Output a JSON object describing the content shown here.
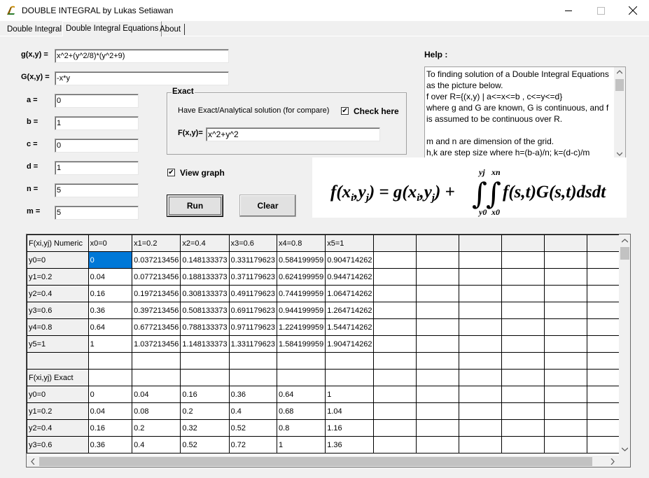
{
  "window": {
    "title": "DOUBLE  INTEGRAL  by Lukas Setiawan"
  },
  "tabs": [
    {
      "label": "Double Integral"
    },
    {
      "label": "Double Integral Equations"
    },
    {
      "label": "About"
    }
  ],
  "form": {
    "g_label": "g(x,y) =",
    "g_value": "x^2+(y^2/8)*(y^2+9)",
    "G_label": "G(x,y) =",
    "G_value": "-x*y",
    "a_label": "a =",
    "a_value": "0",
    "b_label": "b =",
    "b_value": "1",
    "c_label": "c =",
    "c_value": "0",
    "d_label": "d =",
    "d_value": "1",
    "n_label": "n =",
    "n_value": "5",
    "m_label": "m =",
    "m_value": "5"
  },
  "exact": {
    "group_title": "Exact",
    "description": "Have Exact/Analytical solution (for compare)",
    "check_label": "Check here",
    "check_checked": true,
    "F_label": "F(x,y)=",
    "F_value": "x^2+y^2"
  },
  "view_graph": {
    "label": "View graph",
    "checked": true
  },
  "buttons": {
    "run": "Run",
    "clear": "Clear"
  },
  "help": {
    "label": "Help :",
    "text": "To finding solution of a Double Integral Equations as the picture below.\nf over R={(x,y) | a<=x<=b , c<=y<=d}\nwhere g and G are known, G is continuous, and f is assumed to be continuous over R.\n\nm and n are dimension of the grid.\nh,k are step size where h=(b-a)/n; k=(d-c)/m"
  },
  "formula": {
    "text": "f(xi,yj) = g(xi,yj) + ∫∫ f(s,t)G(s,t)dsdt",
    "upper_y": "yj",
    "upper_x": "xn",
    "lower_y": "y0",
    "lower_x": "x0"
  },
  "grid": {
    "header": [
      "F(xi,yj) Numeric",
      "x0=0",
      "x1=0.2",
      "x2=0.4",
      "x3=0.6",
      "x4=0.8",
      "x5=1",
      "",
      "",
      "",
      "",
      "",
      ""
    ],
    "rows": [
      [
        "y0=0",
        "0",
        "0.037213456",
        "0.148133373",
        "0.331179623",
        "0.584199959",
        "0.904714262",
        "",
        "",
        "",
        "",
        "",
        ""
      ],
      [
        "y1=0.2",
        "0.04",
        "0.077213456",
        "0.188133373",
        "0.371179623",
        "0.624199959",
        "0.944714262",
        "",
        "",
        "",
        "",
        "",
        ""
      ],
      [
        "y2=0.4",
        "0.16",
        "0.197213456",
        "0.308133373",
        "0.491179623",
        "0.744199959",
        "1.064714262",
        "",
        "",
        "",
        "",
        "",
        ""
      ],
      [
        "y3=0.6",
        "0.36",
        "0.397213456",
        "0.508133373",
        "0.691179623",
        "0.944199959",
        "1.264714262",
        "",
        "",
        "",
        "",
        "",
        ""
      ],
      [
        "y4=0.8",
        "0.64",
        "0.677213456",
        "0.788133373",
        "0.971179623",
        "1.224199959",
        "1.544714262",
        "",
        "",
        "",
        "",
        "",
        ""
      ],
      [
        "y5=1",
        "1",
        "1.037213456",
        "1.148133373",
        "1.331179623",
        "1.584199959",
        "1.904714262",
        "",
        "",
        "",
        "",
        "",
        ""
      ],
      [
        "",
        "",
        "",
        "",
        "",
        "",
        "",
        "",
        "",
        "",
        "",
        "",
        ""
      ],
      [
        "F(xi,yj) Exact",
        "",
        "",
        "",
        "",
        "",
        "",
        "",
        "",
        "",
        "",
        "",
        ""
      ],
      [
        "y0=0",
        "0",
        "0.04",
        "0.16",
        "0.36",
        "0.64",
        "1",
        "",
        "",
        "",
        "",
        "",
        ""
      ],
      [
        "y1=0.2",
        "0.04",
        "0.08",
        "0.2",
        "0.4",
        "0.68",
        "1.04",
        "",
        "",
        "",
        "",
        "",
        ""
      ],
      [
        "y2=0.4",
        "0.16",
        "0.2",
        "0.32",
        "0.52",
        "0.8",
        "1.16",
        "",
        "",
        "",
        "",
        "",
        ""
      ],
      [
        "y3=0.6",
        "0.36",
        "0.4",
        "0.52",
        "0.72",
        "1",
        "1.36",
        "",
        "",
        "",
        "",
        "",
        ""
      ]
    ],
    "selected": {
      "row": 0,
      "col": 1
    }
  }
}
